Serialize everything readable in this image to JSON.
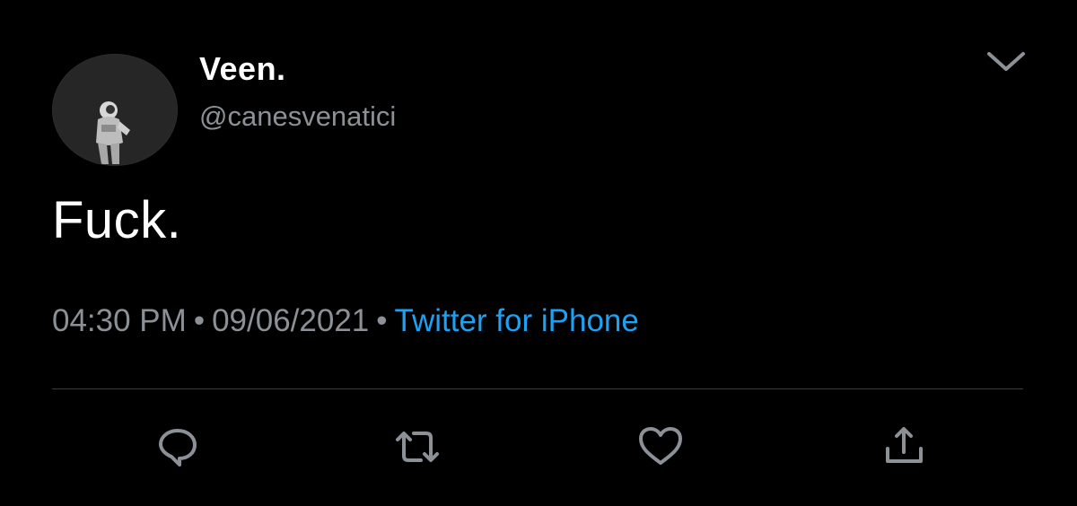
{
  "author": {
    "display_name": "Veen.",
    "handle": "@canesvenatici"
  },
  "tweet": {
    "text": "Fuck.",
    "time": "04:30 PM",
    "separator": "•",
    "date": "09/06/2021",
    "source": "Twitter for iPhone"
  },
  "icons": {
    "menu": "chevron-down-icon",
    "reply": "reply-icon",
    "retweet": "retweet-icon",
    "like": "heart-icon",
    "share": "share-icon"
  },
  "colors": {
    "background": "#000000",
    "text": "#ffffff",
    "muted": "#8b9197",
    "link": "#1da1f2",
    "divider": "#3a3d41"
  }
}
